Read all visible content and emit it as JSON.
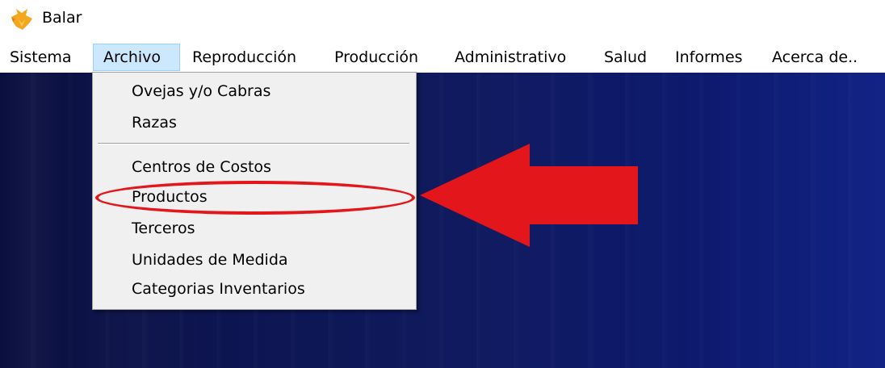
{
  "window": {
    "title": "Balar",
    "icon": "fox-logo-icon"
  },
  "menubar": {
    "items": [
      {
        "label": "Sistema"
      },
      {
        "label": "Archivo",
        "open": true
      },
      {
        "label": "Reproducción"
      },
      {
        "label": "Producción"
      },
      {
        "label": "Administrativo"
      },
      {
        "label": "Salud"
      },
      {
        "label": "Informes"
      },
      {
        "label": "Acerca de.."
      }
    ]
  },
  "archivo_menu": {
    "items": [
      "Ovejas y/o Cabras",
      "Razas",
      "Centros de Costos",
      "Productos",
      "Terceros",
      "Unidades de Medida",
      "Categorias Inventarios"
    ],
    "highlighted_item": "Productos"
  },
  "annotation": {
    "arrow_color": "#e3161b",
    "points_to": "Productos"
  },
  "colors": {
    "menu_open_bg": "#cce8ff",
    "menu_bg": "#f0f0f0",
    "desktop_dark": "#0b0f3f",
    "desktop_light": "#122385"
  }
}
